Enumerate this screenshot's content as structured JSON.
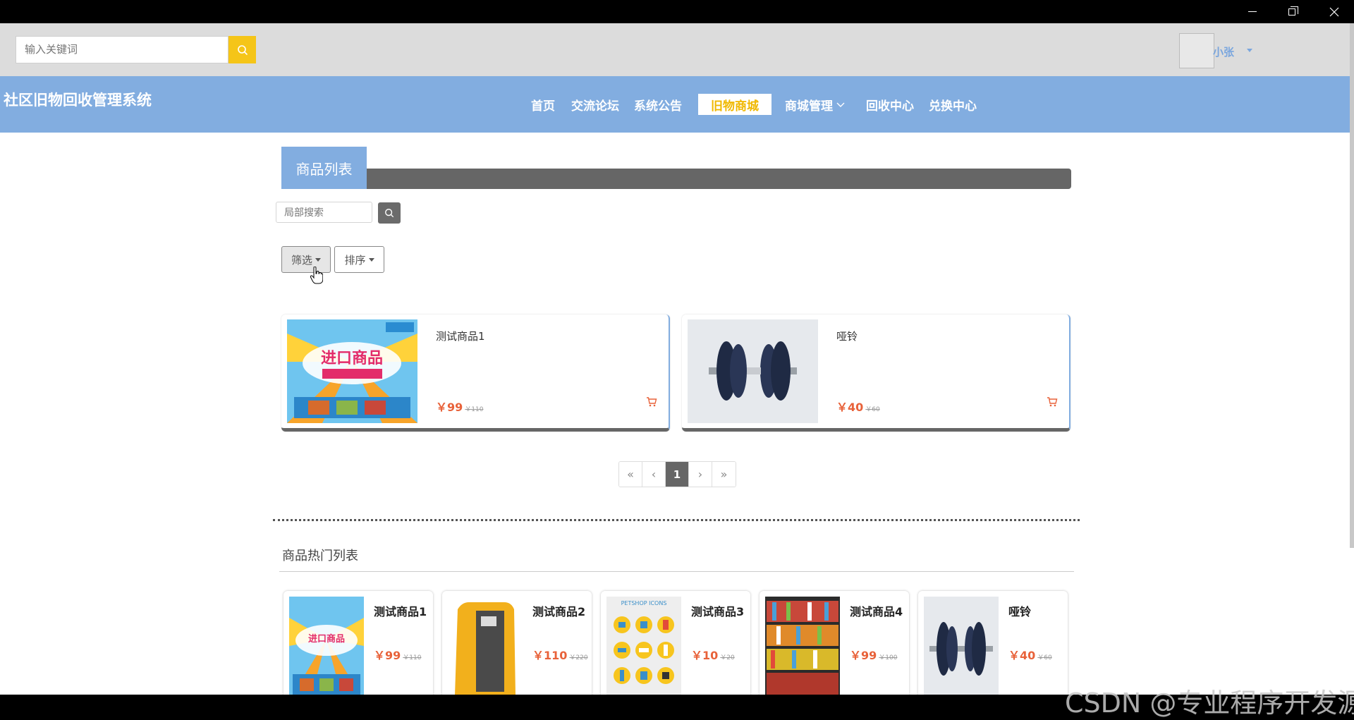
{
  "window": {
    "controls": [
      "minimize-icon",
      "restore-icon",
      "close-icon"
    ]
  },
  "topbar": {
    "search_placeholder": "输入关键词",
    "user_name": "小张"
  },
  "nav": {
    "site_title": "社区旧物回收管理系统",
    "items": [
      {
        "label": "首页"
      },
      {
        "label": "交流论坛"
      },
      {
        "label": "系统公告"
      },
      {
        "label": "旧物商城",
        "active": true
      },
      {
        "label": "商城管理"
      },
      {
        "label": "回收中心"
      },
      {
        "label": "兑换中心"
      }
    ],
    "active_color": "#f0b800",
    "bar_color": "#82ade0"
  },
  "list": {
    "title": "商品列表",
    "local_search_placeholder": "局部搜索",
    "filter_label": "筛选",
    "sort_label": "排序",
    "products": [
      {
        "name": "测试商品1",
        "price": "￥99",
        "old_price": "￥110"
      },
      {
        "name": "哑铃",
        "price": "￥40",
        "old_price": "￥60"
      }
    ]
  },
  "pager": {
    "first": "«",
    "prev": "‹",
    "current": "1",
    "next": "›",
    "last": "»"
  },
  "hot": {
    "title": "商品热门列表",
    "products": [
      {
        "name": "测试商品1",
        "price": "￥99",
        "old_price": "￥110"
      },
      {
        "name": "测试商品2",
        "price": "￥110",
        "old_price": "￥220"
      },
      {
        "name": "测试商品3",
        "price": "￥10",
        "old_price": "￥20"
      },
      {
        "name": "测试商品4",
        "price": "￥99",
        "old_price": "￥100"
      },
      {
        "name": "哑铃",
        "price": "￥40",
        "old_price": "￥60"
      }
    ]
  },
  "watermark": "CSDN @专业程序开发源"
}
